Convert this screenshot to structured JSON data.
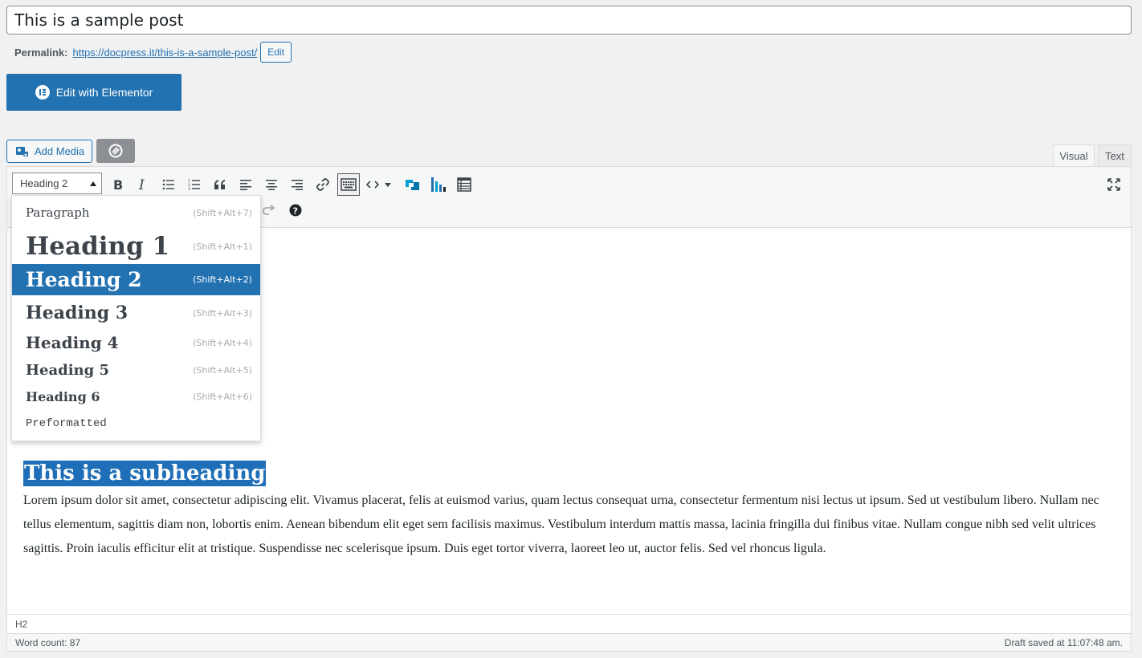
{
  "post": {
    "title": "This is a sample post",
    "permalink_label": "Permalink:",
    "permalink_base": "https://docpress.it/",
    "permalink_slug": "this-is-a-sample-post/",
    "permalink_edit": "Edit"
  },
  "elementor": {
    "label": "Edit with Elementor"
  },
  "media": {
    "add_label": "Add Media"
  },
  "tabs": {
    "visual": "Visual",
    "text": "Text"
  },
  "toolbar": {
    "format_selected": "Heading 2",
    "icons": [
      "bold-icon",
      "italic-icon",
      "bullet-list-icon",
      "numbered-list-icon",
      "blockquote-icon",
      "align-left-icon",
      "align-center-icon",
      "align-right-icon",
      "link-icon",
      "toolbar-toggle-icon",
      "code-icon",
      "dropdown-arrow-icon",
      "plugin-cube-icon",
      "chart-icon",
      "table-icon",
      "fullscreen-icon",
      "redo-icon",
      "help-icon"
    ]
  },
  "format_menu": [
    {
      "label": "Paragraph",
      "shortcut": "(Shift+Alt+7)"
    },
    {
      "label": "Heading 1",
      "shortcut": "(Shift+Alt+1)"
    },
    {
      "label": "Heading 2",
      "shortcut": "(Shift+Alt+2)",
      "selected": true
    },
    {
      "label": "Heading 3",
      "shortcut": "(Shift+Alt+3)"
    },
    {
      "label": "Heading 4",
      "shortcut": "(Shift+Alt+4)"
    },
    {
      "label": "Heading 5",
      "shortcut": "(Shift+Alt+5)"
    },
    {
      "label": "Heading 6",
      "shortcut": "(Shift+Alt+6)"
    },
    {
      "label": "Preformatted",
      "shortcut": ""
    }
  ],
  "content": {
    "subheading": "This is a subheading",
    "paragraph": "Lorem ipsum dolor sit amet, consectetur adipiscing elit. Vivamus placerat, felis at euismod varius, quam lectus consequat urna, consectetur fermentum nisi lectus ut ipsum. Sed ut vestibulum libero. Nullam nec tellus elementum, sagittis diam non, lobortis enim. Aenean bibendum elit eget sem facilisis maximus. Vestibulum interdum mattis massa, lacinia fringilla dui finibus vitae. Nullam congue nibh sed velit ultrices sagittis. Proin iaculis efficitur elit at tristique. Suspendisse nec scelerisque ipsum. Duis eget tortor viverra, laoreet leo ut, auctor felis. Sed vel rhoncus ligula."
  },
  "status": {
    "path": "H2",
    "word_count": "Word count: 87",
    "draft_saved": "Draft saved at 11:07:48 am."
  },
  "colors": {
    "accent": "#2271b1",
    "selection": "#1e6fb8"
  }
}
